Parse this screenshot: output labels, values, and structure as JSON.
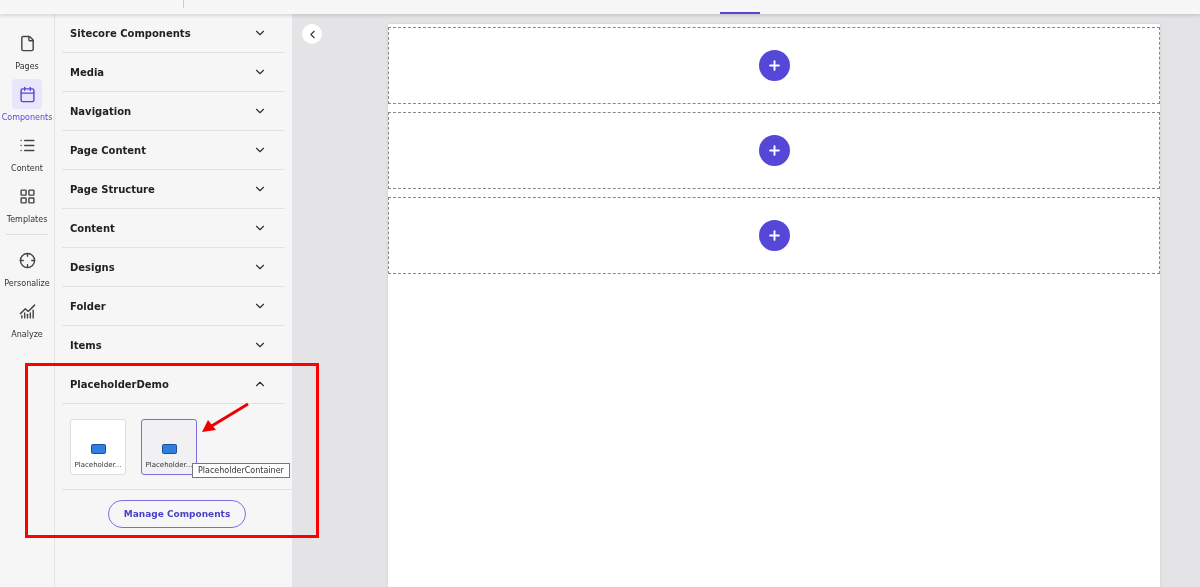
{
  "nav": [
    {
      "label": "Pages",
      "selected": false
    },
    {
      "label": "Components",
      "selected": true
    },
    {
      "label": "Content",
      "selected": false
    },
    {
      "label": "Templates",
      "selected": false
    },
    {
      "label": "Personalize",
      "selected": false,
      "divider_before": true
    },
    {
      "label": "Analyze",
      "selected": false
    }
  ],
  "sections": [
    {
      "label": "Sitecore Components",
      "expanded": false
    },
    {
      "label": "Media",
      "expanded": false
    },
    {
      "label": "Navigation",
      "expanded": false
    },
    {
      "label": "Page Content",
      "expanded": false
    },
    {
      "label": "Page Structure",
      "expanded": false
    },
    {
      "label": "Content",
      "expanded": false
    },
    {
      "label": "Designs",
      "expanded": false
    },
    {
      "label": "Folder",
      "expanded": false
    },
    {
      "label": "Items",
      "expanded": false
    },
    {
      "label": "PlaceholderDemo",
      "expanded": true,
      "components": [
        {
          "label": "Placeholder...",
          "selected": false
        },
        {
          "label": "Placeholder...",
          "selected": true,
          "tooltip": "PlaceholderContainer"
        }
      ]
    }
  ],
  "manage_button": "Manage Components",
  "placeholders": [
    {
      "kind": "empty"
    },
    {
      "kind": "empty"
    },
    {
      "kind": "empty"
    }
  ]
}
